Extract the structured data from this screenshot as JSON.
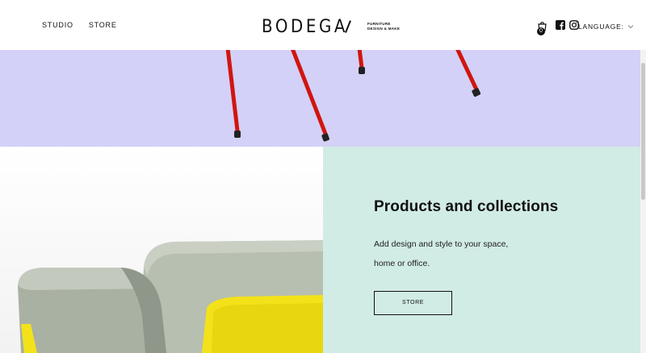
{
  "header": {
    "nav": [
      {
        "label": "STUDIO"
      },
      {
        "label": "STORE"
      }
    ],
    "logo": {
      "word": "BODEGA",
      "tagline_1": "FURNITURE",
      "tagline_2": "DESIGN & MAKE"
    },
    "cart": {
      "icon": "cart-icon",
      "count": "0"
    },
    "social": [
      {
        "icon": "facebook-icon"
      },
      {
        "icon": "instagram-icon"
      }
    ],
    "language": {
      "label": "LANGUAGE:",
      "icon": "chevron-down-icon"
    }
  },
  "hero_band": {
    "color": "#d3d1f7",
    "accent": "#d1150f"
  },
  "products": {
    "title": "Products and collections",
    "text": "Add design and style to your space, home or office.",
    "button": "STORE",
    "color": "#d1ebe5"
  }
}
